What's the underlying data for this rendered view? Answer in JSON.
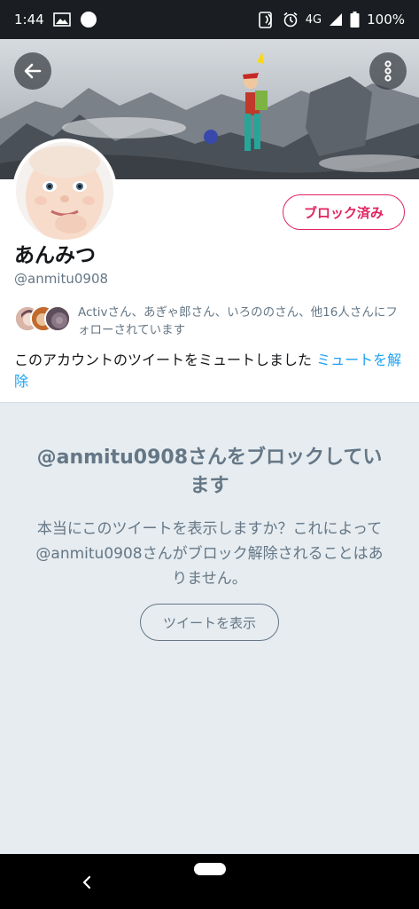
{
  "status_bar": {
    "time": "1:44",
    "network": "4G",
    "battery": "100%",
    "left_icons": [
      "gallery-icon",
      "circle-notification-icon"
    ],
    "right_icons": [
      "nfc-icon",
      "alarm-icon",
      "signal-icon",
      "battery-icon"
    ]
  },
  "header": {
    "back_icon": "arrow-left-icon",
    "more_icon": "vertical-ellipsis-icon"
  },
  "profile": {
    "display_name": "あんみつ",
    "handle": "@anmitu0908",
    "blocked_button_label": "ブロック済み",
    "followed_by_text": "Activさん、あぎゃ郎さん、いろののさん、他16人さんにフォローされています",
    "muted_text": "このアカウントのツイートをミュートしました",
    "unmute_link": "ミュートを解除"
  },
  "block_notice": {
    "title": "@anmitu0908さんをブロックしています",
    "description": "本当にこのツイートを表示しますか？これによって@anmitu0908さんがブロック解除されることはありません。",
    "show_tweets_button": "ツイートを表示"
  },
  "nav_bar": {
    "back_icon": "chevron-left-icon",
    "home_icon": "home-pill-icon"
  },
  "colors": {
    "accent_red": "#e0245e",
    "link_blue": "#1da1f2",
    "muted_gray": "#657786",
    "background": "#e6ecf0"
  }
}
